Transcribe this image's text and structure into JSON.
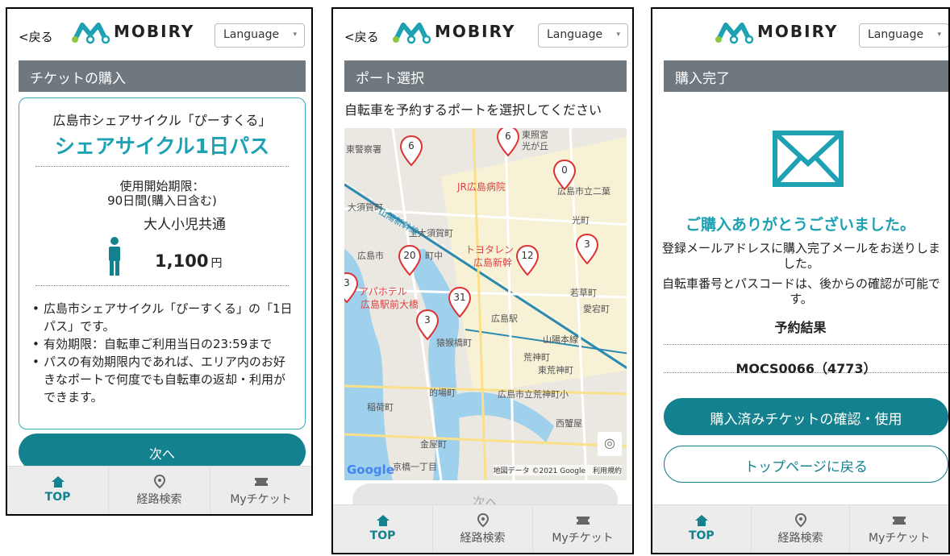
{
  "brand": {
    "name": "MOBIRY",
    "accent": "#14818e",
    "title_color": "#1ea1b3"
  },
  "header": {
    "back_label": "<戻る",
    "language_label": "Language"
  },
  "nav": {
    "top": "TOP",
    "route": "経路検索",
    "tickets": "Myチケット"
  },
  "screen1": {
    "bar_title": "チケットの購入",
    "subtitle": "広島市シェアサイクル「ぴーすくる」",
    "title": "シェアサイクル1日パス",
    "limit_line1": "使用開始期限：",
    "limit_line2": "90日間(購入日含む)",
    "category": "大人小児共通",
    "price": "1,100",
    "currency": "円",
    "notes": [
      "広島市シェアサイクル「ぴーすくる」の「1日パス」です。",
      "有効期限：自転車ご利用当日の23:59まで",
      "パスの有効期限内であれば、エリア内のお好きなポートで何度でも自転車の返却・利用ができます。"
    ],
    "next_label": "次へ"
  },
  "screen2": {
    "bar_title": "ポート選択",
    "instruction": "自転車を予約するポートを選択してください",
    "pins": [
      "6",
      "6",
      "0",
      "20",
      "12",
      "3",
      "31",
      "3",
      "3"
    ],
    "map_labels": {
      "police": "東警察署",
      "hospital": "JR広島病院",
      "osugacho": "大須賀町",
      "kamiosuga": "上大須賀町",
      "hikarimachi": "光町",
      "hiroshima_city": "広島市",
      "nakamachi": "町中",
      "toyota": "トヨタレン",
      "shinkansen_store": "広島新幹",
      "apa": "アパホテル",
      "ekimae": "広島駅前大橋",
      "station": "広島駅",
      "sarukobashi": "猿猴橋町",
      "arakamimachi": "荒神町",
      "higashiarakami": "東荒神町",
      "matobacho": "的場町",
      "arakami_school": "広島市立荒神町小",
      "inarimachi": "稲荷町",
      "kanayamachi": "金屋町",
      "wakakusa": "若草町",
      "atago": "愛宕町",
      "sanyo": "山陽本線",
      "hikarigaoka": "光が丘",
      "toshogu": "東照宮",
      "nishizuruya": "西蟹屋",
      "ichome": "京橋一丁目",
      "shinkansen": "山陽新幹線",
      "futaba": "広島市立二葉"
    },
    "google_label": "Google",
    "copyright": "地図データ ©2021 Google　利用規約",
    "next_label": "次へ"
  },
  "screen3": {
    "bar_title": "購入完了",
    "thanks": "ご購入ありがとうございました。",
    "msg1": "登録メールアドレスに購入完了メールをお送りしました。",
    "msg2": "自転車番号とパスコードは、後からの確認が可能です。",
    "result_title": "予約結果",
    "result_value": "MOCS0066（4773）",
    "confirm_label": "購入済みチケットの確認・使用",
    "top_label": "トップページに戻る"
  }
}
